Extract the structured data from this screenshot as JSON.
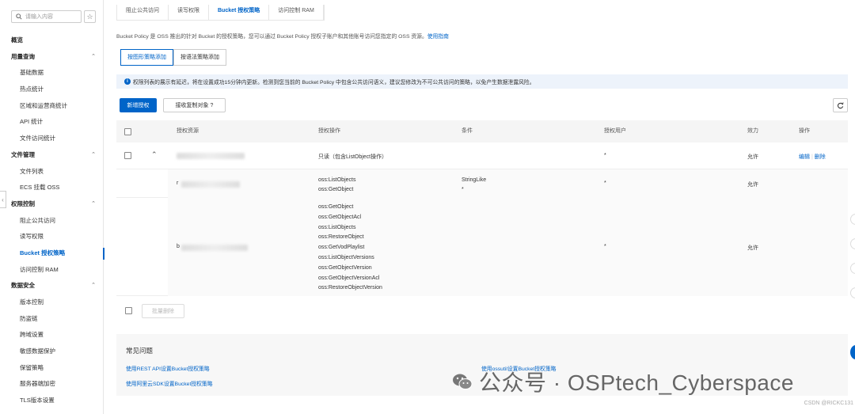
{
  "sidebar": {
    "search_placeholder": "请输入内容",
    "groups": [
      {
        "label": "概览",
        "items": []
      },
      {
        "label": "用量查询",
        "items": [
          "基础数据",
          "热点统计",
          "区域和运营商统计",
          "API 统计",
          "文件访问统计"
        ]
      },
      {
        "label": "文件管理",
        "items": [
          "文件列表",
          "ECS 挂载 OSS"
        ]
      },
      {
        "label": "权限控制",
        "items": [
          "阻止公共访问",
          "读写权限",
          "Bucket 授权策略",
          "访问控制 RAM"
        ]
      },
      {
        "label": "数据安全",
        "items": [
          "版本控制",
          "防盗链",
          "跨域设置",
          "敏感数据保护",
          "保留策略",
          "服务器端加密",
          "TLS版本设置"
        ]
      }
    ],
    "active_item": "Bucket 授权策略"
  },
  "tabs": [
    "阻止公共访问",
    "读写权限",
    "Bucket 授权策略",
    "访问控制 RAM"
  ],
  "active_tab": "Bucket 授权策略",
  "description": "Bucket Policy 是 OSS 推出的针对 Bucket 的授权策略，您可以通过 Bucket Policy 授权子账户和其他账号访问您指定的 OSS 资源。",
  "description_link": "使用指南",
  "mode_buttons": {
    "graphic": "按图形策略添加",
    "syntax": "按语法策略添加"
  },
  "alert_text": "权限列表的展示有延迟，将在设置成功15分钟内更新。检测到您当前的 Bucket Policy 中包含公共访问语义，建议您修改为不可公共访问的策略，以免产生数据泄露风险。",
  "toolbar": {
    "add_label": "新增授权",
    "receive_label": "接收复制对象"
  },
  "table": {
    "headers": {
      "resource": "授权资源",
      "action": "授权操作",
      "condition": "条件",
      "user": "授权用户",
      "effect": "效力",
      "ops": "操作"
    },
    "main_row": {
      "action": "只读（包含ListObject操作）",
      "user": "*",
      "effect": "允许",
      "edit": "编辑",
      "delete": "删除"
    },
    "sub_row_1": {
      "resource_prefix": "r",
      "actions": [
        "oss:ListObjects",
        "oss:GetObject"
      ],
      "condition_key": "StringLike",
      "condition_val": "*",
      "user": "*",
      "effect": "允许"
    },
    "sub_row_2": {
      "resource_prefix": "b",
      "actions": [
        "oss:GetObject",
        "oss:GetObjectAcl",
        "oss:ListObjects",
        "oss:RestoreObject",
        "oss:GetVodPlaylist",
        "oss:ListObjectVersions",
        "oss:GetObjectVersion",
        "oss:GetObjectVersionAcl",
        "oss:RestoreObjectVersion"
      ],
      "user": "*",
      "effect": "允许"
    }
  },
  "bulk_delete": "批量删除",
  "faq": {
    "title": "常见问题",
    "links": [
      "使用REST API设置Bucket授权策略",
      "使用阿里云SDK设置Bucket授权策略",
      "使用ossutil设置Bucket授权策略"
    ]
  },
  "watermark": "公众号 · OSPtech_Cyberspace",
  "csdn": "CSDN @RICKC131"
}
